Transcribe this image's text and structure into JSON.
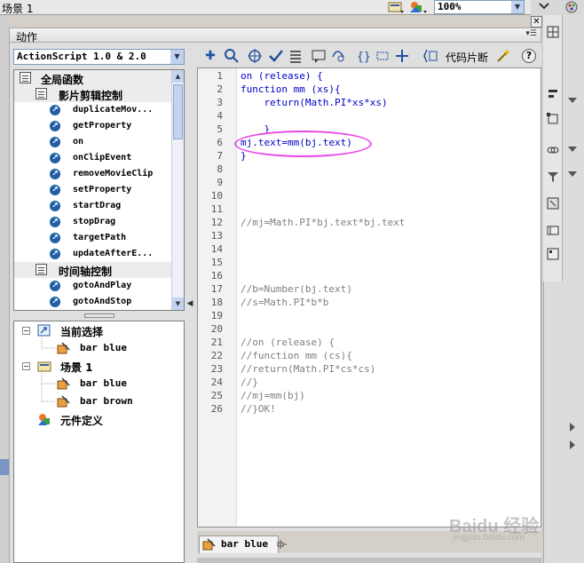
{
  "scene_bar": {
    "scene_label": "场景 1",
    "zoom_value": "100%"
  },
  "actions_panel": {
    "title": "动作",
    "version_select": "ActionScript 1.0 & 2.0",
    "snippet_button": "代码片断",
    "help_button": "?"
  },
  "toolbox": {
    "items": [
      {
        "type": "category",
        "label": "全局函数",
        "indent": 0
      },
      {
        "type": "category",
        "label": "影片剪辑控制",
        "indent": 1
      },
      {
        "type": "item",
        "label": "duplicateMov..."
      },
      {
        "type": "item",
        "label": "getProperty"
      },
      {
        "type": "item",
        "label": "on"
      },
      {
        "type": "item",
        "label": "onClipEvent"
      },
      {
        "type": "item",
        "label": "removeMovieClip"
      },
      {
        "type": "item",
        "label": "setProperty"
      },
      {
        "type": "item",
        "label": "startDrag"
      },
      {
        "type": "item",
        "label": "stopDrag"
      },
      {
        "type": "item",
        "label": "targetPath"
      },
      {
        "type": "item",
        "label": "updateAfterE..."
      },
      {
        "type": "category",
        "label": "时间轴控制",
        "indent": 1
      },
      {
        "type": "item",
        "label": "gotoAndPlay"
      },
      {
        "type": "item",
        "label": "gotoAndStop"
      }
    ]
  },
  "navigator": {
    "current_selection": "当前选择",
    "current_item": "bar blue",
    "scene": "场景 1",
    "scene_items": [
      "bar blue",
      "bar brown"
    ],
    "symbol_definitions": "元件定义"
  },
  "script": {
    "line_numbers": [
      "1",
      "2",
      "3",
      "4",
      "5",
      "6",
      "7",
      "8",
      "9",
      "10",
      "11",
      "12",
      "13",
      "14",
      "15",
      "16",
      "17",
      "18",
      "19",
      "20",
      "21",
      "22",
      "23",
      "24",
      "25",
      "26"
    ],
    "lines": [
      {
        "text": "on (release) {",
        "style": "kw"
      },
      {
        "text": "function mm (xs){",
        "style": "kw"
      },
      {
        "text": "    return(Math.PI*xs*xs)",
        "style": "mix"
      },
      {
        "text": "",
        "style": "plain"
      },
      {
        "text": "    }",
        "style": "kw"
      },
      {
        "text": "mj.text=mm(bj.text)",
        "style": "mix"
      },
      {
        "text": "}",
        "style": "kw"
      },
      {
        "text": "",
        "style": "plain"
      },
      {
        "text": "",
        "style": "plain"
      },
      {
        "text": "",
        "style": "plain"
      },
      {
        "text": "",
        "style": "plain"
      },
      {
        "text": "//mj=Math.PI*bj.text*bj.text",
        "style": "cm"
      },
      {
        "text": "",
        "style": "plain"
      },
      {
        "text": "",
        "style": "plain"
      },
      {
        "text": "",
        "style": "plain"
      },
      {
        "text": "",
        "style": "plain"
      },
      {
        "text": "//b=Number(bj.text)",
        "style": "cm"
      },
      {
        "text": "//s=Math.PI*b*b",
        "style": "cm"
      },
      {
        "text": "",
        "style": "plain"
      },
      {
        "text": "",
        "style": "plain"
      },
      {
        "text": "//on (release) {",
        "style": "cm"
      },
      {
        "text": "//function mm (cs){",
        "style": "cm"
      },
      {
        "text": "//return(Math.PI*cs*cs)",
        "style": "cm"
      },
      {
        "text": "//}",
        "style": "cm"
      },
      {
        "text": "//mj=mm(bj)",
        "style": "cm"
      },
      {
        "text": "//}OK!",
        "style": "cm"
      }
    ]
  },
  "bottom_tab": {
    "label": "bar blue"
  },
  "watermark": {
    "text": "Baidu 经验",
    "sub": "jingyan.baidu.com"
  },
  "colors": {
    "keyword": "#0000c8",
    "comment": "#7f7f7f",
    "highlight": "#e84ae8"
  }
}
